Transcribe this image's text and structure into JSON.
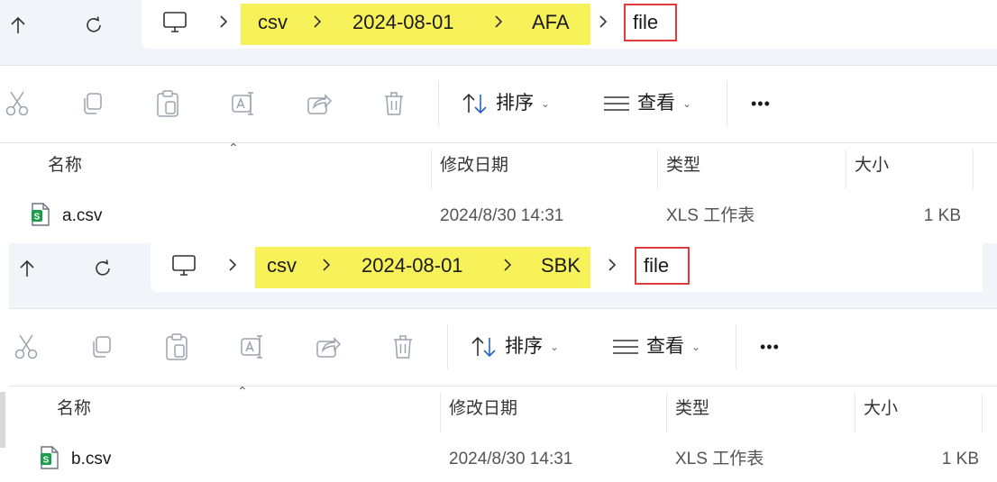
{
  "panels": [
    {
      "breadcrumbs": [
        "csv",
        "2024-08-01",
        "AFA"
      ],
      "current_folder": "file",
      "toolbar": {
        "sort_label": "排序",
        "view_label": "查看",
        "more_label": "•••"
      },
      "columns": {
        "name": "名称",
        "modified": "修改日期",
        "type": "类型",
        "size": "大小"
      },
      "row": {
        "name": "a.csv",
        "modified": "2024/8/30 14:31",
        "type": "XLS 工作表",
        "size": "1 KB"
      }
    },
    {
      "breadcrumbs": [
        "csv",
        "2024-08-01",
        "SBK"
      ],
      "current_folder": "file",
      "toolbar": {
        "sort_label": "排序",
        "view_label": "查看",
        "more_label": "•••"
      },
      "columns": {
        "name": "名称",
        "modified": "修改日期",
        "type": "类型",
        "size": "大小"
      },
      "row": {
        "name": "b.csv",
        "modified": "2024/8/30 14:31",
        "type": "XLS 工作表",
        "size": "1 KB"
      }
    }
  ],
  "colors": {
    "highlight": "#f8f25a",
    "red_outline": "#e23a3a",
    "csv_green": "#1b9e4b",
    "sort_blue": "#2563c9"
  },
  "icons": [
    "up-arrow-icon",
    "refresh-icon",
    "this-pc-icon",
    "chevron-right-icon",
    "cut-icon",
    "copy-icon",
    "paste-icon",
    "rename-icon",
    "share-icon",
    "delete-icon",
    "sort-icon",
    "view-icon",
    "more-icon",
    "csv-file-icon"
  ]
}
